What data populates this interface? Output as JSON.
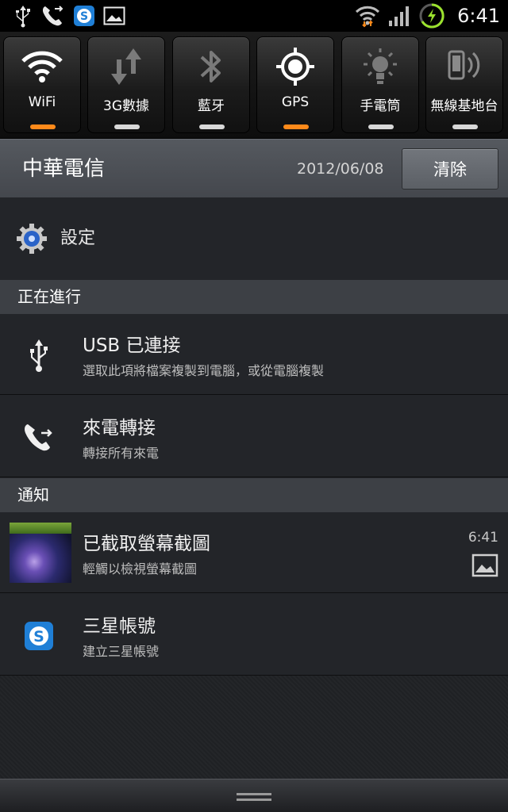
{
  "status_bar": {
    "time": "6:41",
    "left_icons": [
      "usb-icon",
      "phone-forward-icon",
      "samsung-account-icon",
      "gallery-icon"
    ],
    "right_icons": [
      "wifi-icon",
      "signal-icon",
      "battery-charging-icon"
    ]
  },
  "quick_toggles": [
    {
      "label": "WiFi",
      "icon": "wifi-icon",
      "on": true
    },
    {
      "label": "3G數據",
      "icon": "mobile-data-icon",
      "on": false
    },
    {
      "label": "藍牙",
      "icon": "bluetooth-icon",
      "on": false
    },
    {
      "label": "GPS",
      "icon": "gps-icon",
      "on": true
    },
    {
      "label": "手電筒",
      "icon": "flashlight-icon",
      "on": false
    },
    {
      "label": "無線基地台",
      "icon": "hotspot-icon",
      "on": false
    }
  ],
  "header": {
    "carrier": "中華電信",
    "date": "2012/06/08",
    "clear_label": "清除"
  },
  "settings": {
    "label": "設定"
  },
  "ongoing": {
    "title": "正在進行",
    "items": [
      {
        "title": "USB 已連接",
        "subtitle": "選取此項將檔案複製到電腦，或從電腦複製"
      },
      {
        "title": "來電轉接",
        "subtitle": "轉接所有來電"
      }
    ]
  },
  "notifications": {
    "title": "通知",
    "items": [
      {
        "title": "已截取螢幕截圖",
        "subtitle": "輕觸以檢視螢幕截圖",
        "time": "6:41"
      },
      {
        "title": "三星帳號",
        "subtitle": "建立三星帳號"
      }
    ]
  },
  "colors": {
    "accent_on": "#ff8a1a",
    "indicator_off": "#d8d8d8",
    "background": "#232529",
    "section": "#3d4045"
  }
}
